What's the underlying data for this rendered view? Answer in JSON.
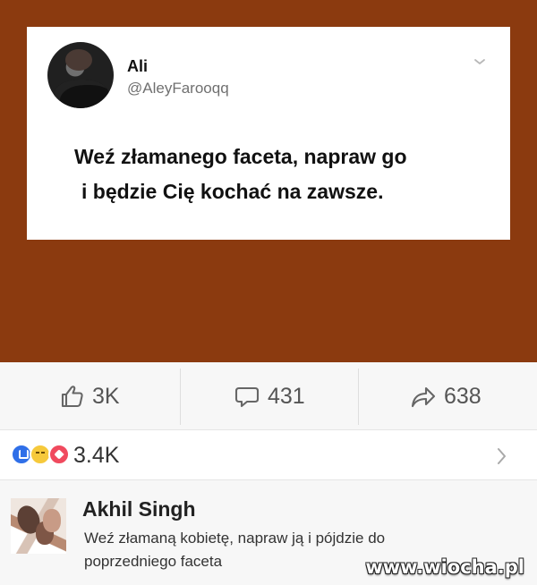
{
  "tweet": {
    "name": "Ali",
    "handle": "@AleyFarooqq",
    "text_line_1": "Weź złamanego faceta, napraw go",
    "text_line_2": "i będzie Cię kochać na zawsze."
  },
  "post_stats": {
    "likes": "3K",
    "comments": "431",
    "shares": "638"
  },
  "reactions": {
    "count": "3.4K",
    "icons": [
      "like-reaction-icon",
      "laugh-reaction-icon",
      "love-reaction-icon"
    ]
  },
  "comment": {
    "author": "Akhil Singh",
    "text": "Weź złamaną kobietę, napraw ją i pójdzie do poprzedniego faceta"
  },
  "watermark": {
    "text": "www.wiocha.pl"
  },
  "colors": {
    "brown_background": "#8b3a0f",
    "reaction_like": "#2f6fe8",
    "reaction_laugh": "#f6c93b",
    "reaction_love": "#f04a5e"
  }
}
